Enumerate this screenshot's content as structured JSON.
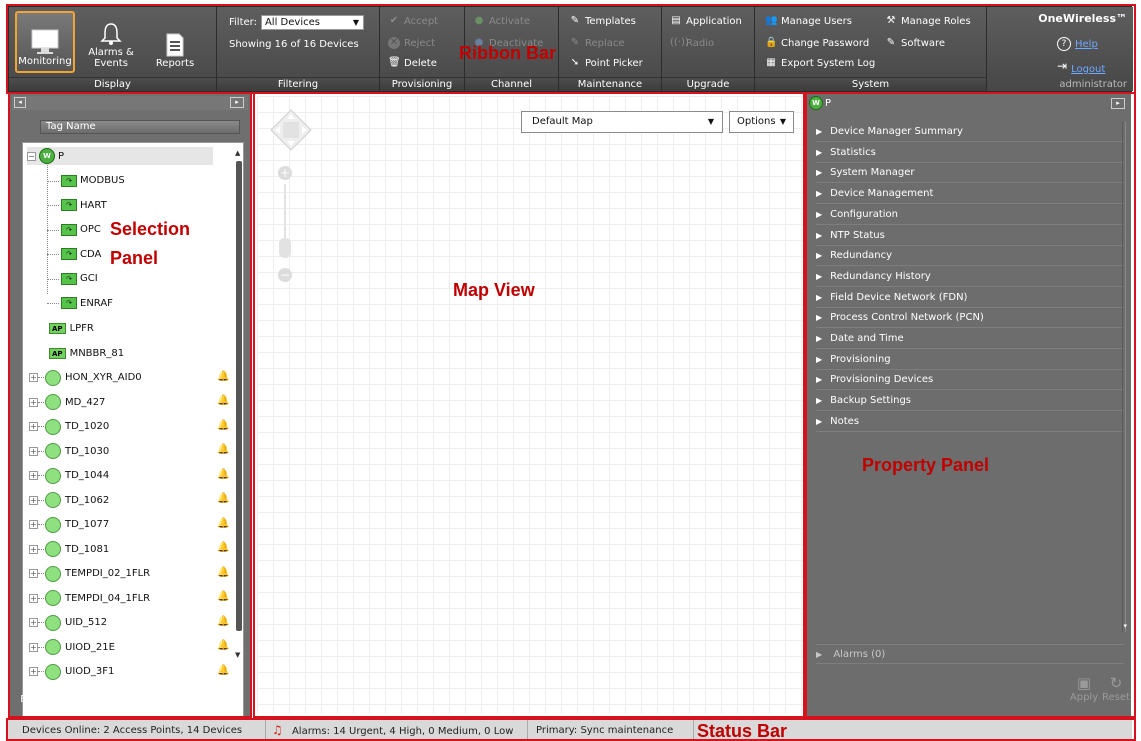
{
  "ribbon": {
    "display": {
      "title": "Display",
      "monitoring": "Monitoring",
      "alarms_events": "Alarms &\nEvents",
      "reports": "Reports"
    },
    "filtering": {
      "title": "Filtering",
      "filter_label": "Filter:",
      "filter_value": "All Devices",
      "showing": "Showing 16 of 16 Devices"
    },
    "provisioning": {
      "title": "Provisioning",
      "accept": "Accept",
      "reject": "Reject",
      "delete": "Delete"
    },
    "channel": {
      "title": "Channel",
      "activate": "Activate",
      "deactivate": "Deactivate"
    },
    "maintenance": {
      "title": "Maintenance",
      "templates": "Templates",
      "replace": "Replace",
      "point_picker": "Point Picker"
    },
    "upgrade": {
      "title": "Upgrade",
      "application": "Application",
      "radio": "Radio"
    },
    "system": {
      "title": "System",
      "manage_users": "Manage Users",
      "manage_roles": "Manage Roles",
      "change_password": "Change Password",
      "software": "Software",
      "export_log": "Export System Log"
    },
    "brand": {
      "name": "OneWireless™",
      "help": "Help",
      "logout": "Logout",
      "user": "administrator"
    }
  },
  "labels": {
    "ribbon_bar": "Ribbon Bar",
    "selection_panel": "Selection\nPanel",
    "map_view": "Map View",
    "property_panel": "Property Panel",
    "status_bar": "Status Bar"
  },
  "selection": {
    "column_header": "Tag Name",
    "root": "P",
    "channels": [
      "MODBUS",
      "HART",
      "OPC",
      "CDA",
      "GCI",
      "ENRAF"
    ],
    "access_points": [
      "LPFR",
      "MNBBR_81"
    ],
    "devices": [
      "HON_XYR_AID0",
      "MD_427",
      "TD_1020",
      "TD_1030",
      "TD_1044",
      "TD_1062",
      "TD_1077",
      "TD_1081",
      "TEMPDI_02_1FLR",
      "TEMPDI_04_1FLR",
      "UID_512",
      "UIOD_21E",
      "UIOD_3F1"
    ],
    "expand": "Expand",
    "collapse": "Collapse"
  },
  "map": {
    "selected_map": "Default Map",
    "options": "Options"
  },
  "property": {
    "header": "P",
    "items": [
      "Device Manager Summary",
      "Statistics",
      "System Manager",
      "Device Management",
      "Configuration",
      "NTP Status",
      "Redundancy",
      "Redundancy History",
      "Field Device Network (FDN)",
      "Process Control Network (PCN)",
      "Date and Time",
      "Provisioning",
      "Provisioning Devices",
      "Backup Settings",
      "Notes"
    ],
    "alarms": "Alarms (0)",
    "apply": "Apply",
    "reset": "Reset"
  },
  "status": {
    "devices_online": "Devices Online: 2 Access Points, 14 Devices",
    "alarms": "Alarms: 14 Urgent, 4 High, 0 Medium, 0 Low",
    "primary": "Primary: Sync maintenance"
  },
  "colors": {
    "frame_red": "#d6121d",
    "label_red": "#c00000",
    "selected_orange": "#f1a333",
    "node_green": "#8fe07f"
  }
}
